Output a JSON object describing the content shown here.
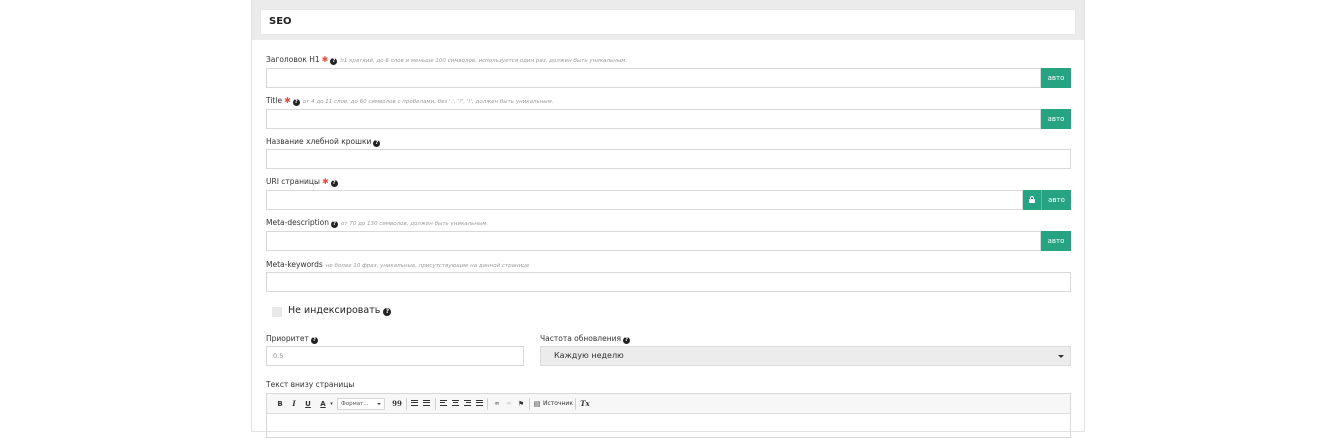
{
  "panel": {
    "title": "SEO"
  },
  "fields": {
    "h1": {
      "label": "Заголовок H1",
      "hint": "h1 краткий, до 6 слов и меньше 100 символов, используется один раз, должен быть уникальным.",
      "auto_label": "авто",
      "value": ""
    },
    "title": {
      "label": "Title",
      "hint": "от 4 до 11 слов, до 60 символов с пробелами, без '.', '?', '!', должен быть уникальным.",
      "auto_label": "авто",
      "value": ""
    },
    "breadcrumb": {
      "label": "Название хлебной крошки",
      "value": ""
    },
    "uri": {
      "label": "URI страницы",
      "auto_label": "авто",
      "lock_icon": "lock-icon",
      "value": ""
    },
    "meta_description": {
      "label": "Meta-description",
      "hint": "от 70 до 130 символов, должен быть уникальным.",
      "auto_label": "авто",
      "value": ""
    },
    "meta_keywords": {
      "label": "Meta-keywords",
      "hint": "не более 10 фраз, уникальные, присутствующие на данной странице",
      "value": ""
    }
  },
  "noindex": {
    "label": "Не индексировать",
    "checked": false
  },
  "priority": {
    "label": "Приоритет",
    "value": "0.5"
  },
  "frequency": {
    "label": "Частота обновления",
    "selected": "Каждую неделю"
  },
  "bottom_text": {
    "label": "Текст внизу страницы",
    "toolbar": {
      "bold": "B",
      "italic": "I",
      "underline": "U",
      "text_color": "A",
      "format": "Формат...",
      "blockquote": "99",
      "source": "Источник",
      "remove_format": "Tx"
    }
  },
  "colors": {
    "accent": "#26a482",
    "required": "#e74c3c",
    "header_bg": "#ebebeb"
  }
}
